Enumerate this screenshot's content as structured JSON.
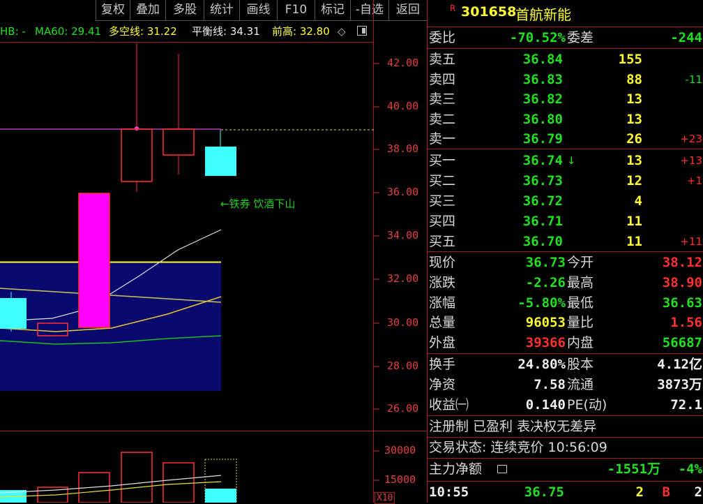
{
  "toolbar": {
    "buttons": [
      "复权",
      "叠加",
      "多股",
      "统计",
      "画线",
      "F10",
      "标记",
      "-自选",
      "返回"
    ]
  },
  "indicators": {
    "hb": "HB: -",
    "ma60": "MA60: 29.41",
    "duokong": "多空线: 31.22",
    "pingheng": "平衡线: 34.31",
    "qiangao": "前高: 32.80",
    "diamond": "◇"
  },
  "price_axis": [
    "42.00",
    "40.00",
    "38.00",
    "36.00",
    "34.00",
    "32.00",
    "30.00",
    "28.00",
    "26.00"
  ],
  "volume_axis": [
    "30000",
    "15000",
    "X10"
  ],
  "annotation": "←铁券 饮酒下山",
  "stock": {
    "badge": "R",
    "code": "301658",
    "name": "首航新能"
  },
  "weibi": {
    "label1": "委比",
    "value1": "-70.52%",
    "label2": "委差",
    "value2": "-244"
  },
  "sell": [
    {
      "label": "卖五",
      "price": "36.84",
      "vol": "155",
      "chg": ""
    },
    {
      "label": "卖四",
      "price": "36.83",
      "vol": "88",
      "chg": "-11"
    },
    {
      "label": "卖三",
      "price": "36.82",
      "vol": "13",
      "chg": ""
    },
    {
      "label": "卖二",
      "price": "36.80",
      "vol": "13",
      "chg": ""
    },
    {
      "label": "卖一",
      "price": "36.79",
      "vol": "26",
      "chg": "+23"
    }
  ],
  "buy": [
    {
      "label": "买一",
      "price": "36.74",
      "arrow": "↓",
      "vol": "13",
      "chg": "+13"
    },
    {
      "label": "买二",
      "price": "36.73",
      "arrow": "",
      "vol": "12",
      "chg": "+1"
    },
    {
      "label": "买三",
      "price": "36.72",
      "arrow": "",
      "vol": "4",
      "chg": ""
    },
    {
      "label": "买四",
      "price": "36.71",
      "arrow": "",
      "vol": "11",
      "chg": ""
    },
    {
      "label": "买五",
      "price": "36.70",
      "arrow": "",
      "vol": "11",
      "chg": "+11"
    }
  ],
  "quote": [
    {
      "l1": "现价",
      "v1": "36.73",
      "l2": "今开",
      "v2": "38.12"
    },
    {
      "l1": "涨跌",
      "v1": "-2.26",
      "l2": "最高",
      "v2": "38.90"
    },
    {
      "l1": "涨幅",
      "v1": "-5.80%",
      "l2": "最低",
      "v2": "36.63"
    },
    {
      "l1": "总量",
      "v1": "96053",
      "l2": "量比",
      "v2": "1.56"
    },
    {
      "l1": "外盘",
      "v1": "39366",
      "l2": "内盘",
      "v2": "56687"
    }
  ],
  "fund": [
    {
      "l1": "换手",
      "v1": "24.80%",
      "l2": "股本",
      "v2": "4.12亿"
    },
    {
      "l1": "净资",
      "v1": "7.58",
      "l2": "流通",
      "v2": "3873万"
    },
    {
      "l1": "收益㈠",
      "v1": "0.140",
      "l2": "PE(动)",
      "v2": "72.1"
    }
  ],
  "tags": "注册制 已盈利 表决权无差异",
  "trade_status": "交易状态: 连续竞价 10:56:09",
  "main_net": {
    "label": "主力净额",
    "value": "-1551万",
    "pct": "-4%"
  },
  "tick": {
    "time": "10:55",
    "price": "36.75",
    "vol": "2",
    "side": "B",
    "count": "2"
  },
  "colors": {
    "up": "#ff3030",
    "down": "#20e020",
    "accent": "#ffff30",
    "bg": "#000000",
    "border": "#a02020"
  }
}
